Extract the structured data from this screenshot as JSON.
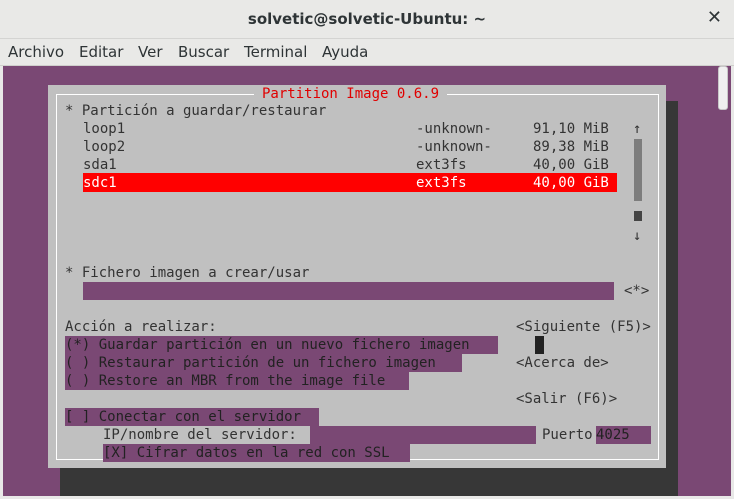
{
  "window": {
    "title": "solvetic@solvetic-Ubuntu: ~",
    "close": "✕"
  },
  "menu": [
    "Archivo",
    "Editar",
    "Ver",
    "Buscar",
    "Terminal",
    "Ayuda"
  ],
  "dialog": {
    "title": "Partition Image 0.6.9",
    "partitions_header": "* Partición a guardar/restaurar",
    "partitions": [
      {
        "name": "loop1",
        "fs": "-unknown-",
        "size": "91,10 MiB"
      },
      {
        "name": "loop2",
        "fs": "-unknown-",
        "size": "89,38 MiB"
      },
      {
        "name": "sda1",
        "fs": "ext3fs",
        "size": "40,00 GiB"
      },
      {
        "name": "sdc1",
        "fs": "ext3fs",
        "size": "40,00 GiB"
      }
    ],
    "scroll_up": "↑",
    "scroll_down": "↓",
    "image_header": "* Fichero imagen a crear/usar",
    "image_browse": "<*>",
    "action_header": "Acción a realizar:",
    "actions": [
      "(*) Guardar partición en un nuevo fichero imagen",
      "( ) Restaurar partición de un fichero imagen",
      "( ) Restore an MBR from the image file"
    ],
    "btn_next": "<Siguiente (F5)>",
    "btn_about": "<Acerca de>",
    "btn_exit": "<Salir (F6)>",
    "server_checkbox": "[ ] Conectar con el servidor",
    "server_label": "IP/nombre del servidor:",
    "port_label": "Puerto",
    "port_value": "4025",
    "ssl_checkbox": "[X] Cifrar datos en la red con SSL"
  }
}
